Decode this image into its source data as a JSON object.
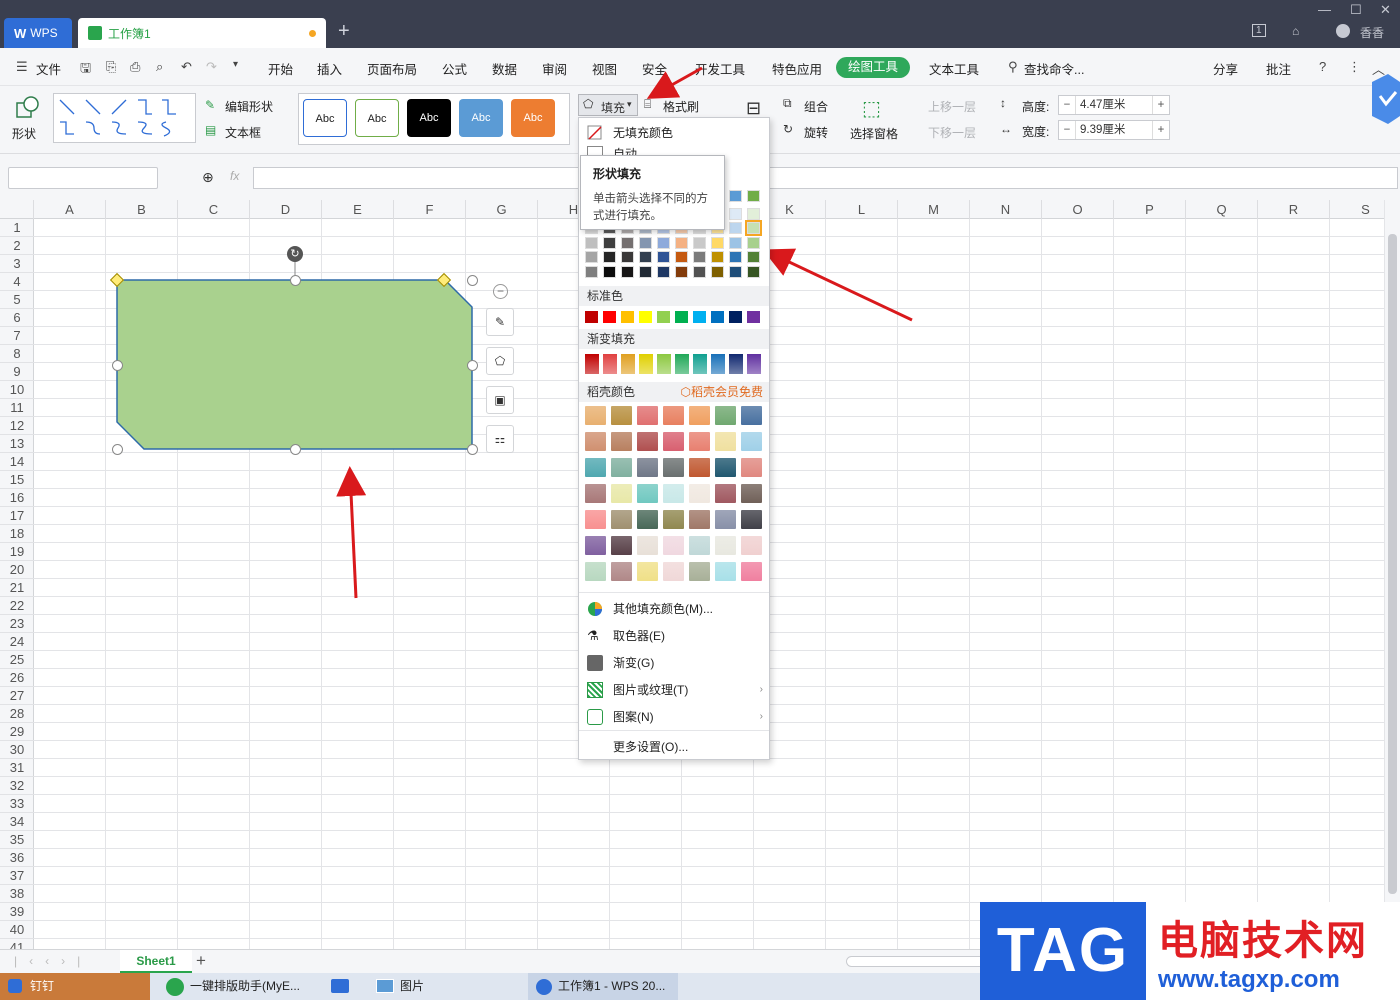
{
  "titlebar": {
    "wps_tab": "WPS",
    "doc_tab": "工作簿1",
    "add_tab": "+",
    "user": "香香",
    "page_badge": "1"
  },
  "menubar": {
    "file": "文件",
    "items": [
      "开始",
      "插入",
      "页面布局",
      "公式",
      "数据",
      "审阅",
      "视图",
      "安全",
      "开发工具",
      "特色应用",
      "绘图工具",
      "文本工具"
    ],
    "search": "查找命令...",
    "share": "分享",
    "comment": "批注"
  },
  "ribbon": {
    "shape_label": "形状",
    "edit_shape": "编辑形状",
    "textbox": "文本框",
    "style_text": "Abc",
    "fill": "填充",
    "format_painter": "格式刷",
    "group": "组合",
    "rotate": "旋转",
    "selection_pane": "选择窗格",
    "bring_forward": "上移一层",
    "send_backward": "下移一层",
    "height_label": "高度:",
    "height_value": "4.47厘米",
    "width_label": "宽度:",
    "width_value": "9.39厘米"
  },
  "formula_bar": {
    "fx": "fx"
  },
  "columns": [
    "A",
    "B",
    "C",
    "D",
    "E",
    "F",
    "G",
    "H",
    "I",
    "J",
    "K",
    "L",
    "M",
    "N",
    "O",
    "P",
    "Q",
    "R",
    "S"
  ],
  "rows": [
    "1",
    "2",
    "3",
    "4",
    "5",
    "6",
    "7",
    "8",
    "9",
    "10",
    "11",
    "12",
    "13",
    "14",
    "15",
    "16",
    "17",
    "18",
    "19",
    "20",
    "21",
    "22",
    "23",
    "24",
    "25",
    "26",
    "27",
    "28",
    "29",
    "30",
    "31",
    "32",
    "33",
    "34",
    "35",
    "36",
    "37",
    "38",
    "39",
    "40",
    "41"
  ],
  "dropdown": {
    "no_fill": "无填充颜色",
    "auto": "自动",
    "standard_colors_title": "标准色",
    "gradient_title": "渐变填充",
    "premium_title": "稻壳颜色",
    "premium_badge": "稻壳会员免费",
    "more_colors": "其他填充颜色(M)...",
    "eyedropper": "取色器(E)",
    "gradient": "渐变(G)",
    "picture": "图片或纹理(T)",
    "pattern": "图案(N)",
    "more_settings": "更多设置(O)...",
    "standard_colors": [
      "#c00000",
      "#ff0000",
      "#ffc000",
      "#ffff00",
      "#92d050",
      "#00b050",
      "#00b0f0",
      "#0070c0",
      "#002060",
      "#7030a0"
    ],
    "gradient_colors": [
      "#c00000",
      "#e04040",
      "#e0a020",
      "#e0d000",
      "#8cc840",
      "#20a858",
      "#10a090",
      "#1870b8",
      "#102870",
      "#6030a0"
    ],
    "premium_colors": [
      [
        "#e8b070",
        "#b89040",
        "#e07070",
        "#e88060",
        "#f0a060",
        "#70a870",
        "#4870a0"
      ],
      [
        "#d09070",
        "#b88060",
        "#b05050",
        "#d86070",
        "#e88070",
        "#f0e0a0",
        "#a0d0e8"
      ],
      [
        "#50a8b0",
        "#80b0a0",
        "#707888",
        "#6a7070",
        "#c05830",
        "#205870",
        "#e08880"
      ],
      [
        "#a87878",
        "#e8e8a8",
        "#70c8c0",
        "#c8e8e8",
        "#f0e8e0",
        "#a05860",
        "#706058"
      ],
      [
        "#f89090",
        "#a09070",
        "#486858",
        "#908850",
        "#a07868",
        "#8890a8",
        "#404048"
      ],
      [
        "#8060a0",
        "#584048",
        "#e8e0d8",
        "#f0d8e0",
        "#c0d8d8",
        "#e8e8e0",
        "#f0d0d0"
      ],
      [
        "#b8d8c0",
        "#b08888",
        "#f0e088",
        "#f0d8d8",
        "#a8b098",
        "#a8e0e8",
        "#f080a0"
      ]
    ]
  },
  "tooltip": {
    "title": "形状填充",
    "body_line1": "单击箭头选择不同的方",
    "body_line2": "式进行填充。"
  },
  "shape": {
    "fill_color": "#a9d18e",
    "border_color": "#2e6aa8"
  },
  "sheet": {
    "tab": "Sheet1",
    "add": "+"
  },
  "taskbar": {
    "items": [
      "钉钉",
      "一键排版助手(MyE...",
      "",
      "图片",
      "工作簿1 - WPS 20..."
    ]
  },
  "watermark": {
    "tag": "TAG",
    "site_name": "电脑技术网",
    "url": "www.tagxp.com"
  }
}
